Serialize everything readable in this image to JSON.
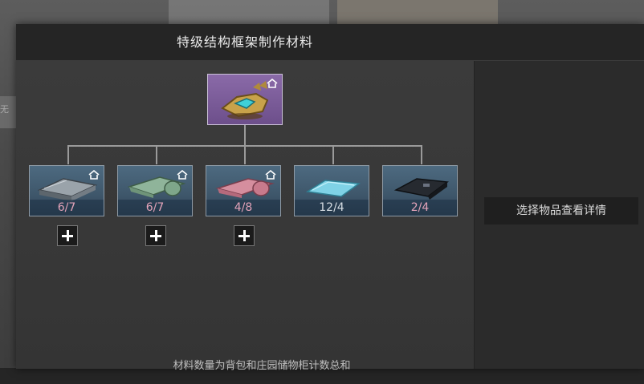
{
  "background": {
    "left_partial_text": "无"
  },
  "modal": {
    "title": "特级结构框架制作材料",
    "detail_hint": "选择物品查看详情",
    "footnote": "材料数量为背包和庄园储物柜计数总和"
  },
  "root_item": {
    "icon": "hover-vehicle-icon",
    "rarity_color": "#7a5a9a",
    "home_marker": true
  },
  "materials": [
    {
      "icon": "metal-plate-stack-icon",
      "count": "6/7",
      "sufficient": false,
      "home_marker": true,
      "addable": true
    },
    {
      "icon": "green-cloth-roll-icon",
      "count": "6/7",
      "sufficient": false,
      "home_marker": true,
      "addable": true
    },
    {
      "icon": "pink-cloth-roll-icon",
      "count": "4/8",
      "sufficient": false,
      "home_marker": true,
      "addable": true
    },
    {
      "icon": "blue-sheet-icon",
      "count": "12/4",
      "sufficient": true,
      "home_marker": false,
      "addable": false
    },
    {
      "icon": "black-fabric-icon",
      "count": "2/4",
      "sufficient": false,
      "home_marker": false,
      "addable": false
    }
  ],
  "colors": {
    "insufficient_count": "#e3a3b9",
    "sufficient_count": "#d6dde3",
    "item_frame": "#4d6a80"
  }
}
